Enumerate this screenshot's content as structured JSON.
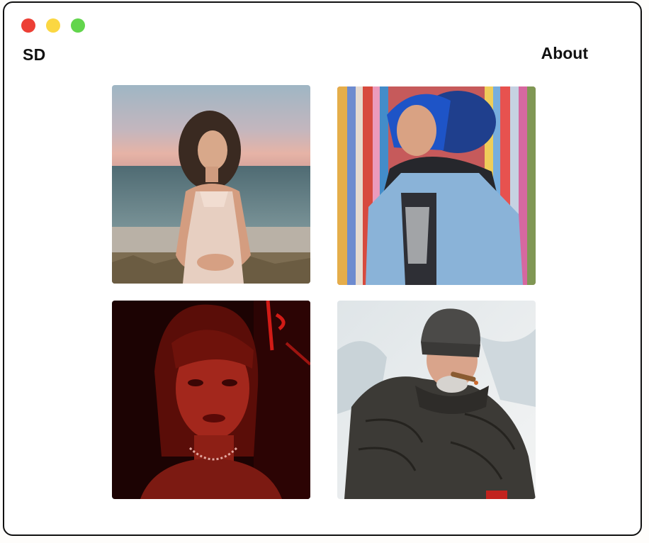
{
  "window": {
    "controls": [
      {
        "name": "close",
        "color": "#ec3f35"
      },
      {
        "name": "minimize",
        "color": "#fbd742"
      },
      {
        "name": "maximize",
        "color": "#62d54c"
      }
    ]
  },
  "header": {
    "brand": "SD",
    "nav_about": "About"
  },
  "gallery": {
    "photos": [
      {
        "subject": "woman-beach-sunset"
      },
      {
        "subject": "person-blue-hair-denim-jacket"
      },
      {
        "subject": "woman-red-neon-light"
      },
      {
        "subject": "man-winter-hat-cigar"
      }
    ]
  }
}
